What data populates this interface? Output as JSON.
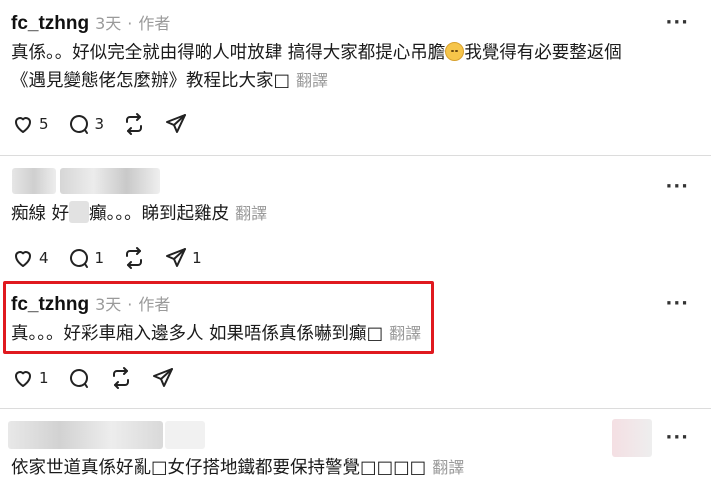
{
  "posts": [
    {
      "username": "fc_tzhng",
      "time": "3天",
      "dot": "·",
      "author_tag": "作者",
      "line1": "真係。。好似完全就由得啲人咁放肆 搞得大家都提心吊膽",
      "line1b": "我覺得有必要整返個",
      "line2": "《遇見變態佬怎麼辦》教程比大家",
      "translate": "翻譯",
      "likes": "5",
      "replies": "3",
      "shares": ""
    },
    {
      "line1a": "痴線 好",
      "line1b": "癲。。。睇到起雞皮",
      "translate": "翻譯",
      "likes": "4",
      "replies": "1",
      "shares": "1"
    },
    {
      "username": "fc_tzhng",
      "time": "3天",
      "dot": "·",
      "author_tag": "作者",
      "line1": "真。。。好彩車廂入邊多人 如果唔係真係嚇到癲",
      "translate": "翻譯",
      "likes": "1",
      "replies": "",
      "shares": ""
    },
    {
      "line1": "依家世道真係好亂",
      "line1b": "女仔搭地鐵都要保持警覺",
      "translate": "翻譯"
    }
  ],
  "glyphs": {
    "missing": "□",
    "missing4": "□□□□",
    "more": "···"
  },
  "colors": {
    "highlight": "#e0191f",
    "meta": "#9a9a9a",
    "divider": "#dcdcdc"
  }
}
